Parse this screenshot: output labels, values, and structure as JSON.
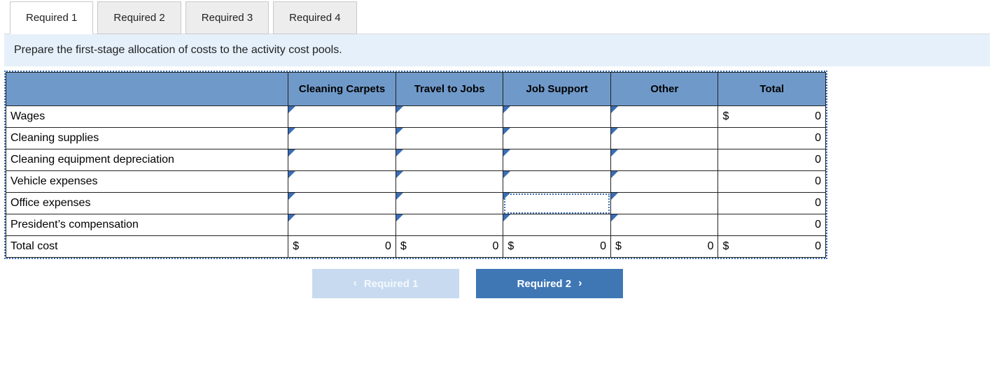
{
  "tabs": [
    {
      "label": "Required 1",
      "active": true
    },
    {
      "label": "Required 2",
      "active": false
    },
    {
      "label": "Required 3",
      "active": false
    },
    {
      "label": "Required 4",
      "active": false
    }
  ],
  "instruction": "Prepare the first-stage allocation of costs to the activity cost pools.",
  "columns": [
    "Cleaning Carpets",
    "Travel to Jobs",
    "Job Support",
    "Other",
    "Total"
  ],
  "rows": [
    {
      "label": "Wages",
      "dollar": "$",
      "total": "0"
    },
    {
      "label": "Cleaning supplies",
      "dollar": "",
      "total": "0"
    },
    {
      "label": "Cleaning equipment depreciation",
      "dollar": "",
      "total": "0"
    },
    {
      "label": "Vehicle expenses",
      "dollar": "",
      "total": "0"
    },
    {
      "label": "Office expenses",
      "dollar": "",
      "total": "0"
    },
    {
      "label": "President’s compensation",
      "dollar": "",
      "total": "0"
    }
  ],
  "selected_cell": {
    "row": 4,
    "col": 2
  },
  "totals_row": {
    "label": "Total cost",
    "cells": [
      {
        "dollar": "$",
        "value": "0"
      },
      {
        "dollar": "$",
        "value": "0"
      },
      {
        "dollar": "$",
        "value": "0"
      },
      {
        "dollar": "$",
        "value": "0"
      },
      {
        "dollar": "$",
        "value": "0"
      }
    ]
  },
  "nav": {
    "prev": {
      "label": "Required 1",
      "glyph": "‹"
    },
    "next": {
      "label": "Required 2",
      "glyph": "›"
    }
  }
}
